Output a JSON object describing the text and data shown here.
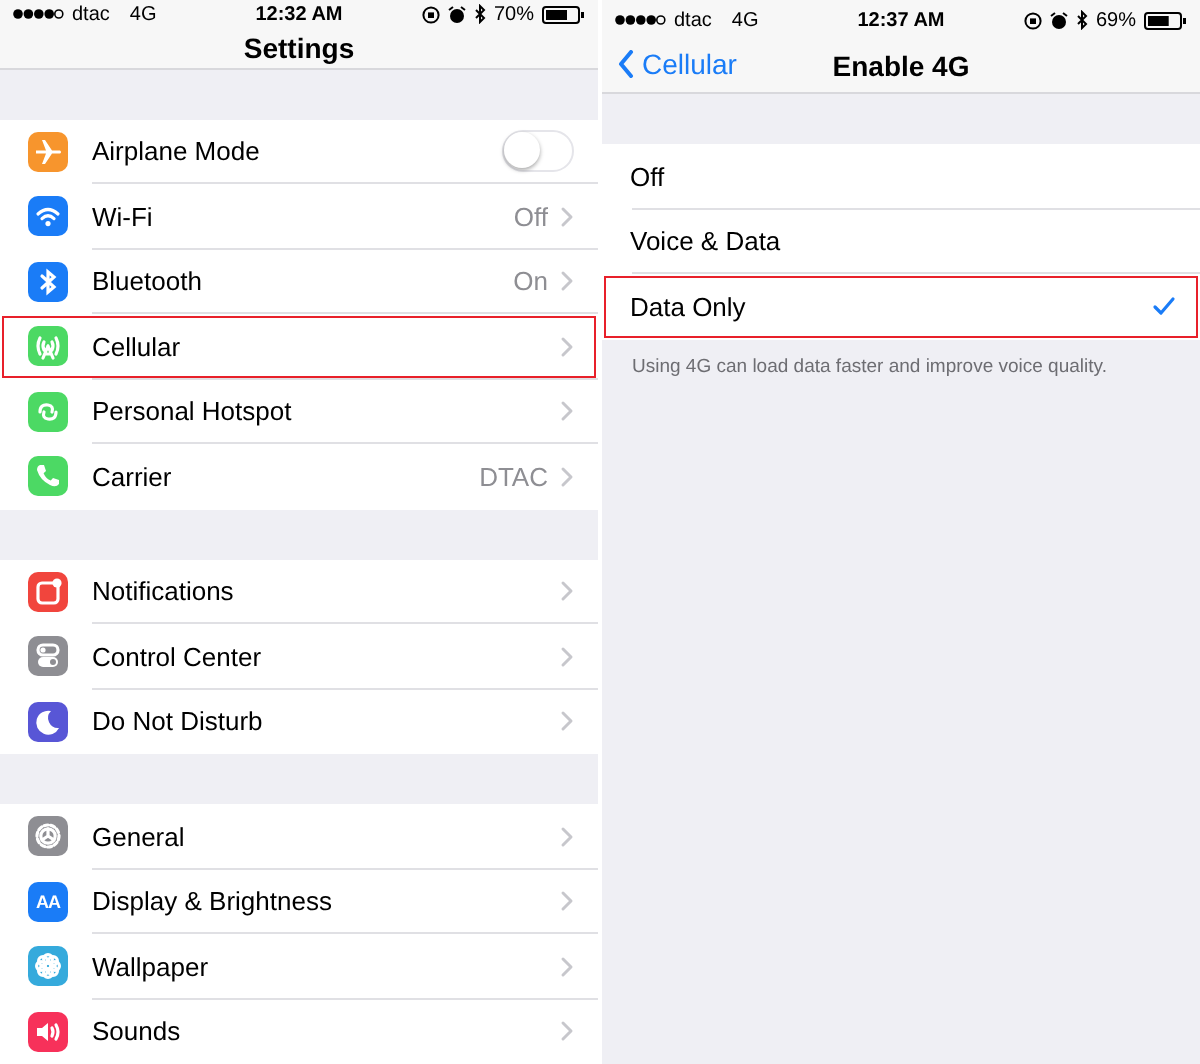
{
  "panels": [
    {
      "status_bar": {
        "carrier": "dtac",
        "network": "4G",
        "time": "12:32 AM",
        "battery": "70%"
      },
      "nav": {
        "title": "Settings"
      },
      "groups": [
        {
          "rows": [
            {
              "kind": "toggle",
              "label": "Airplane Mode",
              "on": false,
              "color": "#f7952d",
              "highlighted": false
            },
            {
              "kind": "link",
              "label": "Wi-Fi",
              "value": "Off",
              "color": "#1a7cf7",
              "highlighted": false
            },
            {
              "kind": "link",
              "label": "Bluetooth",
              "value": "On",
              "color": "#1a7cf7",
              "highlighted": false
            },
            {
              "kind": "link",
              "label": "Cellular",
              "color": "#4cd964",
              "highlighted": true
            },
            {
              "kind": "link",
              "label": "Personal Hotspot",
              "color": "#4cd964",
              "highlighted": false
            },
            {
              "kind": "link",
              "label": "Carrier",
              "value": "DTAC",
              "color": "#4cd964",
              "highlighted": false
            }
          ]
        },
        {
          "rows": [
            {
              "kind": "link",
              "label": "Notifications",
              "color": "#f1453d",
              "highlighted": false
            },
            {
              "kind": "link",
              "label": "Control Center",
              "color": "#8e8e93",
              "highlighted": false
            },
            {
              "kind": "link",
              "label": "Do Not Disturb",
              "color": "#5856d6",
              "highlighted": false
            }
          ]
        },
        {
          "rows": [
            {
              "kind": "link",
              "label": "General",
              "color": "#8e8e93",
              "highlighted": false
            },
            {
              "kind": "link",
              "label": "Display & Brightness",
              "icon_text": "AA",
              "color": "#1a7cf7",
              "highlighted": false
            },
            {
              "kind": "link",
              "label": "Wallpaper",
              "color": "#35aadc",
              "highlighted": false
            },
            {
              "kind": "link",
              "label": "Sounds",
              "color": "#f7315a",
              "highlighted": false
            }
          ]
        }
      ]
    },
    {
      "status_bar": {
        "carrier": "dtac",
        "network": "4G",
        "time": "12:37 AM",
        "battery": "69%"
      },
      "nav": {
        "title": "Enable 4G",
        "back": "Cellular"
      },
      "groups": [
        {
          "rows": [
            {
              "kind": "option",
              "label": "Off",
              "selected": false,
              "highlighted": false
            },
            {
              "kind": "option",
              "label": "Voice & Data",
              "selected": false,
              "highlighted": false
            },
            {
              "kind": "option",
              "label": "Data Only",
              "selected": true,
              "highlighted": true
            }
          ],
          "footer": "Using 4G can load data faster and improve voice quality."
        }
      ]
    }
  ]
}
